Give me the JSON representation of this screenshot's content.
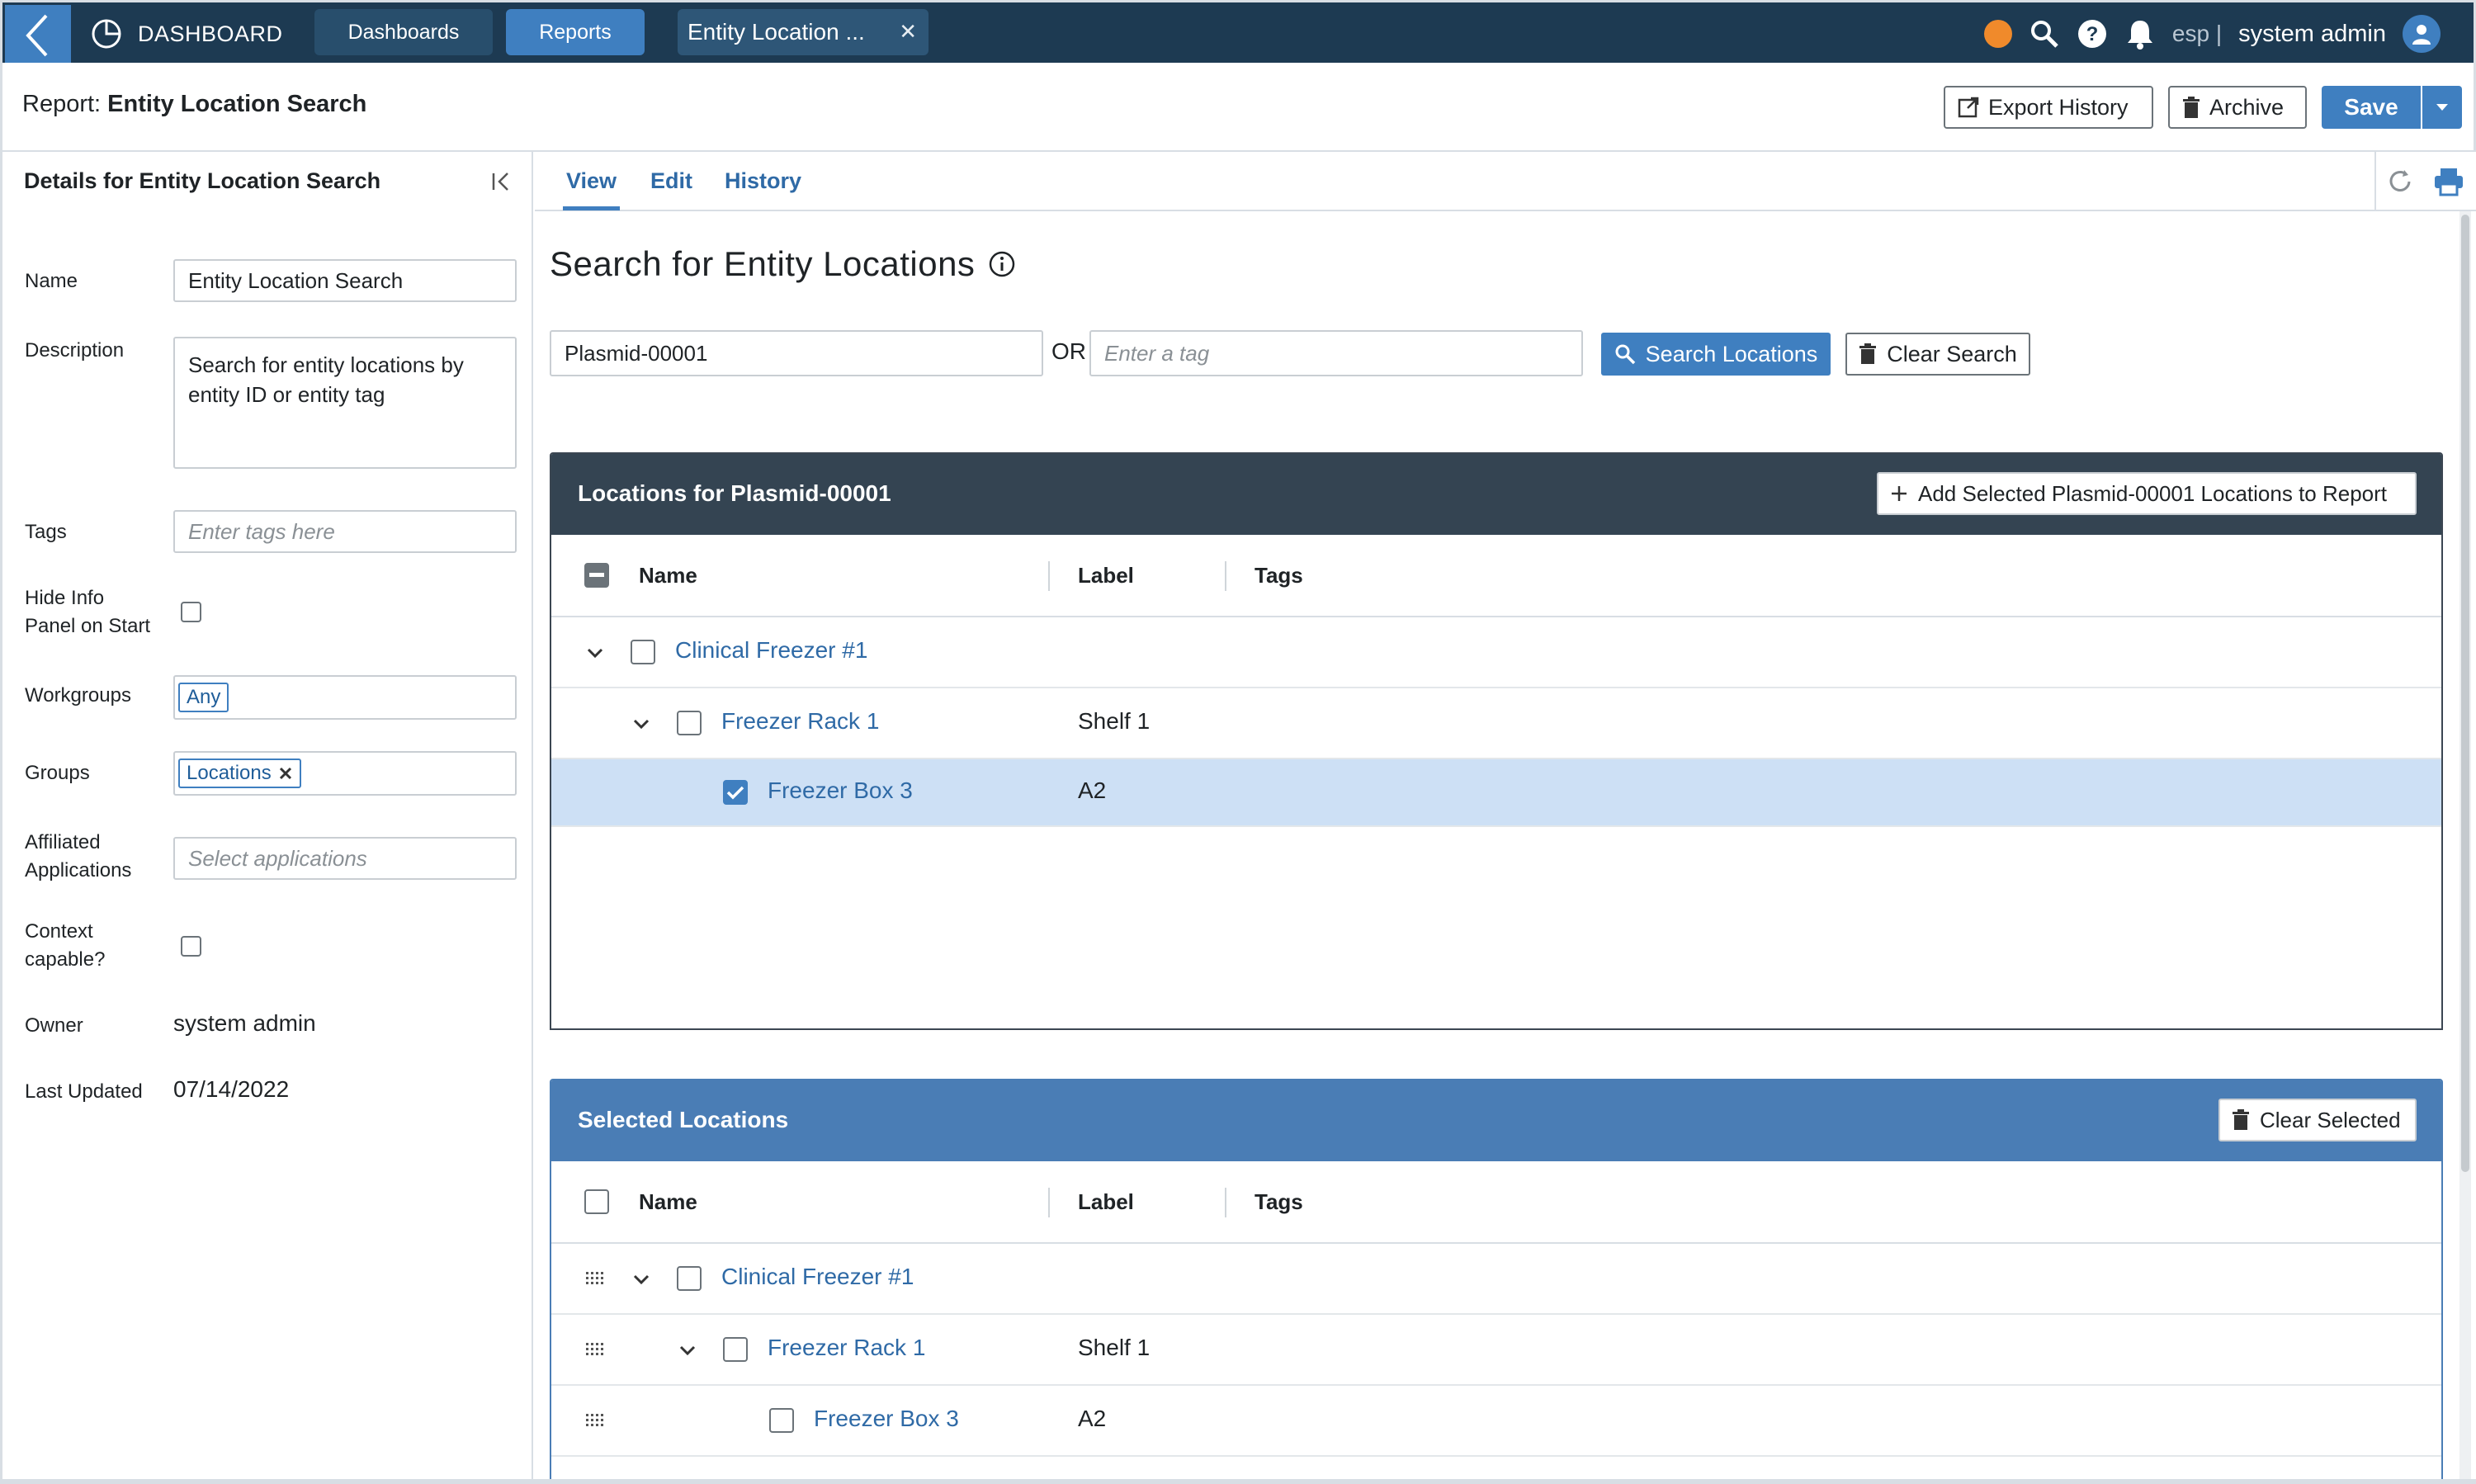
{
  "topbar": {
    "brand": "DASHBOARD",
    "nav_dashboards": "Dashboards",
    "nav_reports": "Reports",
    "open_tab": "Entity Location ...",
    "lang": "esp |",
    "user": "system admin"
  },
  "header": {
    "report_prefix": "Report:",
    "report_name": "Entity Location Search",
    "export_history": "Export History",
    "archive": "Archive",
    "save": "Save"
  },
  "details": {
    "title": "Details for Entity Location Search",
    "name_label": "Name",
    "name_value": "Entity Location Search",
    "description_label": "Description",
    "description_value": "Search for entity locations by entity ID or entity tag",
    "tags_label": "Tags",
    "tags_placeholder": "Enter tags here",
    "hide_info_label_1": "Hide Info",
    "hide_info_label_2": "Panel on Start",
    "workgroups_label": "Workgroups",
    "workgroups_chip": "Any",
    "groups_label": "Groups",
    "groups_chip": "Locations",
    "affiliated_label_1": "Affiliated",
    "affiliated_label_2": "Applications",
    "affiliated_placeholder": "Select applications",
    "context_label_1": "Context",
    "context_label_2": "capable?",
    "owner_label": "Owner",
    "owner_value": "system admin",
    "updated_label": "Last Updated",
    "updated_value": "07/14/2022"
  },
  "tabs": {
    "view": "View",
    "edit": "Edit",
    "history": "History"
  },
  "search": {
    "title": "Search for Entity Locations",
    "entity_value": "Plasmid-00001",
    "or": "OR",
    "tag_placeholder": "Enter a tag",
    "search_button": "Search Locations",
    "clear_button": "Clear Search"
  },
  "locations_panel": {
    "title": "Locations for Plasmid-00001",
    "add_button": "Add Selected Plasmid-00001 Locations to Report",
    "columns": {
      "name": "Name",
      "label": "Label",
      "tags": "Tags"
    },
    "rows": [
      {
        "name": "Clinical Freezer #1",
        "label": "",
        "checked": false
      },
      {
        "name": "Freezer Rack 1",
        "label": "Shelf 1",
        "checked": false
      },
      {
        "name": "Freezer Box 3",
        "label": "A2",
        "checked": true
      }
    ]
  },
  "selected_panel": {
    "title": "Selected Locations",
    "clear_button": "Clear Selected",
    "columns": {
      "name": "Name",
      "label": "Label",
      "tags": "Tags"
    },
    "rows": [
      {
        "name": "Clinical Freezer #1",
        "label": ""
      },
      {
        "name": "Freezer Rack 1",
        "label": "Shelf 1"
      },
      {
        "name": "Freezer Box 3",
        "label": "A2"
      }
    ]
  },
  "colors": {
    "nav_bg": "#1d3a52",
    "accent": "#3f7fc0",
    "selected_row": "#cde0f5",
    "status_dot": "#f08a2b"
  }
}
